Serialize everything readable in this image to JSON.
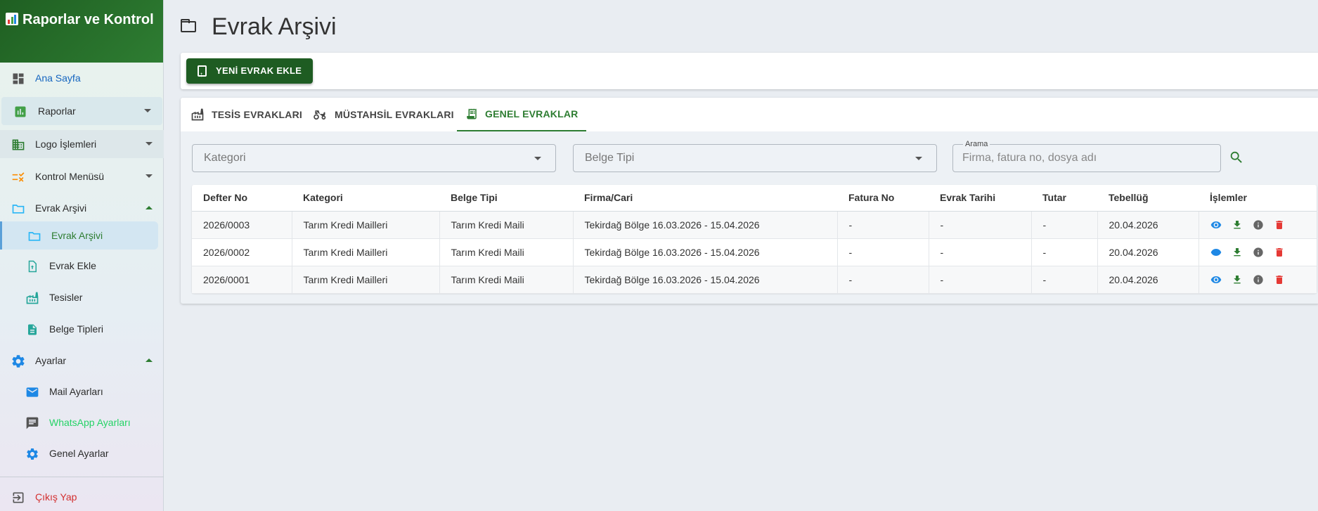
{
  "sidebar": {
    "title": "Raporlar ve Kontrol",
    "items": [
      {
        "label": "Ana Sayfa"
      },
      {
        "label": "Raporlar"
      },
      {
        "label": "Logo İşlemleri"
      },
      {
        "label": "Kontrol Menüsü"
      },
      {
        "label": "Evrak Arşivi"
      },
      {
        "label": "Evrak Arşivi"
      },
      {
        "label": "Evrak Ekle"
      },
      {
        "label": "Tesisler"
      },
      {
        "label": "Belge Tipleri"
      },
      {
        "label": "Ayarlar"
      },
      {
        "label": "Mail Ayarları"
      },
      {
        "label": "WhatsApp Ayarları"
      },
      {
        "label": "Genel Ayarlar"
      },
      {
        "label": "Çıkış Yap"
      }
    ]
  },
  "page": {
    "title": "Evrak Arşivi"
  },
  "toolbar": {
    "add_label": "YENİ EVRAK EKLE"
  },
  "tabs": [
    {
      "label": "TESİS EVRAKLARI"
    },
    {
      "label": "MÜSTAHSİL EVRAKLARI"
    },
    {
      "label": "GENEL EVRAKLAR"
    }
  ],
  "filters": {
    "category_placeholder": "Kategori",
    "doc_type_placeholder": "Belge Tipi",
    "search_label": "Arama",
    "search_placeholder": "Firma, fatura no, dosya adı"
  },
  "table": {
    "headers": [
      "Defter No",
      "Kategori",
      "Belge Tipi",
      "Firma/Cari",
      "Fatura No",
      "Evrak Tarihi",
      "Tutar",
      "Tebellüğ",
      "İşlemler"
    ],
    "rows": [
      [
        "2026/0003",
        "Tarım Kredi Mailleri",
        "Tarım Kredi Maili",
        "Tekirdağ Bölge 16.03.2026 - 15.04.2026",
        "-",
        "-",
        "-",
        "20.04.2026"
      ],
      [
        "2026/0002",
        "Tarım Kredi Mailleri",
        "Tarım Kredi Maili",
        "Tekirdağ Bölge 16.03.2026 - 15.04.2026",
        "-",
        "-",
        "-",
        "20.04.2026"
      ],
      [
        "2026/0001",
        "Tarım Kredi Mailleri",
        "Tarım Kredi Maili",
        "Tekirdağ Bölge 16.03.2026 - 15.04.2026",
        "-",
        "-",
        "-",
        "20.04.2026"
      ]
    ]
  },
  "colors": {
    "brand_green": "#2e7d32",
    "button_green": "#1e5c22",
    "delete_red": "#e53935",
    "view_blue": "#1e88e5",
    "whatsapp_green": "#25d366",
    "logout_red": "#d32f2f",
    "link_blue": "#1565c0"
  },
  "icons": {
    "action_view": "eye-icon",
    "action_download": "download-icon",
    "action_info": "info-icon",
    "action_delete": "delete-icon"
  }
}
